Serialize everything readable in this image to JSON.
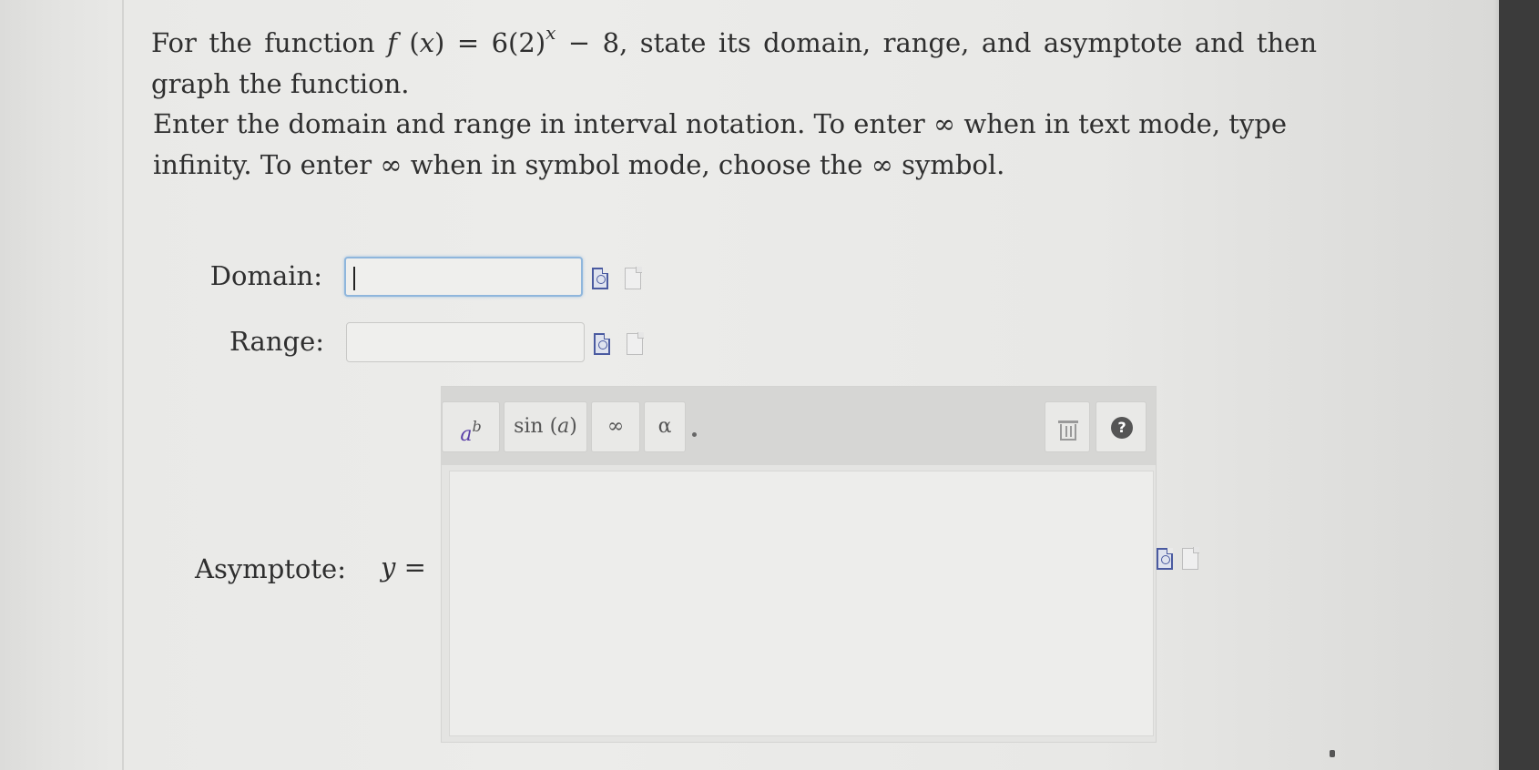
{
  "question": {
    "lead": "For the function",
    "func_name": "f",
    "func_var": "x",
    "rhs_coef": "6(2)",
    "rhs_exp": "x",
    "rhs_tail": "− 8",
    "trail": ", state its domain, range, and asymptote and then graph the function."
  },
  "instructions": "Enter the domain and range in interval notation. To enter ∞ when in text mode, type infinity. To enter ∞ when in symbol mode, choose the ∞ symbol.",
  "fields": {
    "domain_label": "Domain:",
    "domain_value": "",
    "range_label": "Range:",
    "range_value": "",
    "asymptote_label": "Asymptote:",
    "asymptote_prefix": "y",
    "asymptote_equals": "=",
    "asymptote_value": ""
  },
  "toolbar": {
    "power_base": "a",
    "power_exp": "b",
    "sin_label_prefix": "sin (",
    "sin_label_arg": "a",
    "sin_label_suffix": ")",
    "infinity_label": "∞",
    "alpha_label": "α",
    "help_label": "?"
  },
  "icons": {
    "preview": "preview-doc-icon",
    "blank": "blank-doc-icon",
    "trash": "trash-icon",
    "help": "help-icon"
  }
}
